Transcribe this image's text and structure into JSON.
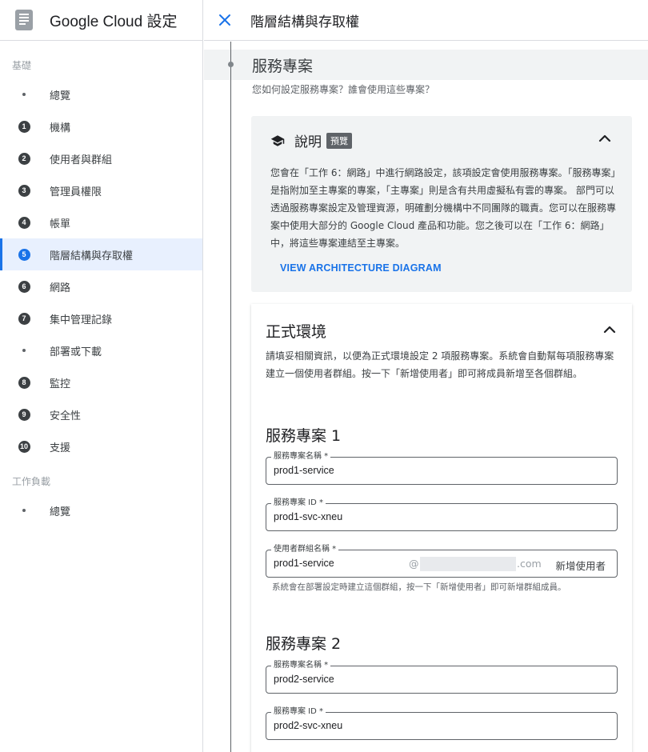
{
  "app": {
    "title": "Google Cloud 設定"
  },
  "header": {
    "title": "階層結構與存取權"
  },
  "sidebar": {
    "sections": [
      {
        "label": "基礎"
      },
      {
        "label": "工作負載"
      }
    ],
    "items": [
      {
        "marker": "",
        "label": "總覽"
      },
      {
        "marker": "1",
        "label": "機構"
      },
      {
        "marker": "2",
        "label": "使用者與群組"
      },
      {
        "marker": "3",
        "label": "管理員權限"
      },
      {
        "marker": "4",
        "label": "帳單"
      },
      {
        "marker": "5",
        "label": "階層結構與存取權",
        "active": true
      },
      {
        "marker": "6",
        "label": "網路"
      },
      {
        "marker": "7",
        "label": "集中管理記錄"
      },
      {
        "marker": "",
        "label": "部署或下載"
      },
      {
        "marker": "8",
        "label": "監控"
      },
      {
        "marker": "9",
        "label": "安全性"
      },
      {
        "marker": "10",
        "label": "支援"
      },
      {
        "marker": "",
        "label": "總覽"
      }
    ]
  },
  "step": {
    "title": "服務專案",
    "subtitle": "您如何設定服務專案？誰會使用這些專案？"
  },
  "explain": {
    "title": "說明",
    "badge": "預覽",
    "body": "您會在「工作 6：網路」中進行網路設定，該項設定會使用服務專案。「服務專案」是指附加至主專案的專案，「主專案」則是含有共用虛擬私有雲的專案。 部門可以透過服務專案設定及管理資源，明確劃分機構中不同團隊的職責。您可以在服務專案中使用大部分的 Google Cloud 產品和功能。您之後可以在「工作 6：網路」中，將這些專案連結至主專案。",
    "link": "VIEW ARCHITECTURE DIAGRAM"
  },
  "production": {
    "title": "正式環境",
    "description": "請填妥相關資訊，以便為正式環境設定 2 項服務專案。系統會自動幫每項服務專案建立一個使用者群組。按一下「新增使用者」即可將成員新增至各個群組。",
    "service1": {
      "heading": "服務專案 1",
      "name_label": "服務專案名稱 *",
      "name_value": "prod1-service",
      "id_label": "服務專案 ID *",
      "id_value": "prod1-svc-xneu",
      "group_label": "使用者群組名稱 *",
      "group_value": "prod1-service",
      "group_at": "@",
      "group_domain": ".com",
      "add_user": "新增使用者",
      "group_hint": "系統會在部署設定時建立這個群組，按一下「新增使用者」即可新增群組成員。"
    },
    "service2": {
      "heading": "服務專案 2",
      "name_label": "服務專案名稱 *",
      "name_value": "prod2-service",
      "id_label": "服務專案 ID *",
      "id_value": "prod2-svc-xneu"
    }
  },
  "colors": {
    "accent": "#1a73e8",
    "card_bg": "#f1f3f4",
    "active_bg": "#e8f0fe"
  }
}
